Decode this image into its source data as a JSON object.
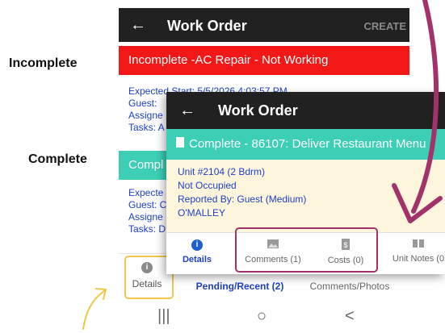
{
  "labels": {
    "incomplete": "Incomplete",
    "complete": "Complete"
  },
  "back_phone": {
    "title": "Work Order",
    "create": "CREATE",
    "red_banner": "Incomplete -AC Repair - Not Working",
    "info1": [
      "Expected Start: 5/5/2026 4:03:57 PM",
      "Guest:",
      "Assigne",
      "Tasks: A"
    ],
    "teal_banner": "Compl",
    "info2": [
      "Expecte",
      "Guest: C",
      "Assigne",
      "Tasks: D"
    ],
    "nav": {
      "details": "Details",
      "pending": "Pending/Recent (2)",
      "comments_photos": "Comments/Photos"
    }
  },
  "front_phone": {
    "title": "Work Order",
    "banner": "Complete - 86107: Deliver Restaurant Menu",
    "lines": [
      "Unit #2104 (2 Bdrm)",
      "Not Occupied",
      "Reported By: Guest  (Medium)",
      "O'MALLEY"
    ],
    "tabs": {
      "details": "Details",
      "comments": "Comments (1)",
      "costs": "Costs (0)",
      "unit_notes": "Unit Notes (0"
    }
  },
  "icons": [
    "back-arrow-icon",
    "info-icon",
    "image-icon",
    "receipt-icon",
    "book-icon",
    "document-icon"
  ],
  "colors": {
    "red": "#f21818",
    "teal": "#3ccfb6",
    "highlight": "#a3316a",
    "yellow": "#f1c64a",
    "dark": "#212121"
  }
}
